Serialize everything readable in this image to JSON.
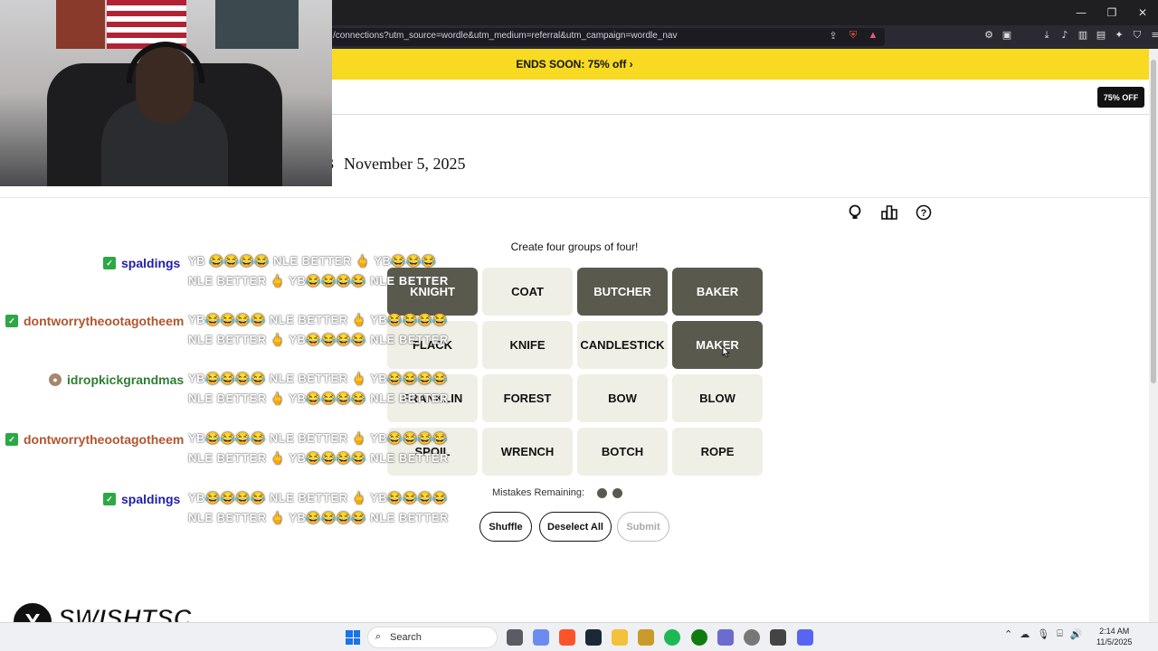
{
  "browser": {
    "url": "/connections?utm_source=wordle&utm_medium=referral&utm_campaign=wordle_nav",
    "window_controls": [
      "—",
      "❐",
      "✕"
    ]
  },
  "promo": {
    "text": "ENDS SOON:  75% off ›"
  },
  "header": {
    "off_button": "75% OFF"
  },
  "game": {
    "date_prefix": "3",
    "date": "November 5, 2025",
    "instructions": "Create four groups of four!",
    "tiles": [
      {
        "word": "KNIGHT",
        "selected": true
      },
      {
        "word": "COAT",
        "selected": false
      },
      {
        "word": "BUTCHER",
        "selected": true
      },
      {
        "word": "BAKER",
        "selected": true
      },
      {
        "word": "FLACK",
        "selected": false
      },
      {
        "word": "KNIFE",
        "selected": false
      },
      {
        "word": "CANDLESTICK",
        "selected": false
      },
      {
        "word": "MAKER",
        "selected": true
      },
      {
        "word": "FRANKLIN",
        "selected": false
      },
      {
        "word": "FOREST",
        "selected": false
      },
      {
        "word": "BOW",
        "selected": false
      },
      {
        "word": "BLOW",
        "selected": false
      },
      {
        "word": "SPOIL",
        "selected": false
      },
      {
        "word": "WRENCH",
        "selected": false
      },
      {
        "word": "BOTCH",
        "selected": false
      },
      {
        "word": "ROPE",
        "selected": false
      }
    ],
    "mistakes_label": "Mistakes Remaining:",
    "mistakes_remaining": 2,
    "buttons": {
      "shuffle": "Shuffle",
      "deselect": "Deselect All",
      "submit": "Submit"
    }
  },
  "chat": [
    {
      "user": "spaldings",
      "color": "#1e1eaa",
      "message": "YB 😂😂😂😂 NLE BETTER 🖕 YB😂😂😂 NLE BETTER 🖕 YB😂😂😂😂 NLE BETTER"
    },
    {
      "user": "dontworrytheootagotheem",
      "color": "#b0552e",
      "message": "YB😂😂😂😂 NLE BETTER 🖕 YB😂😂😂😂 NLE BETTER 🖕 YB😂😂😂😂 NLE BETTER"
    },
    {
      "user": "idropkickgrandmas",
      "color": "#2e7d32",
      "message": "YB😂😂😂😂 NLE BETTER 🖕 YB😂😂😂😂 NLE BETTER 🖕 YB😂😂😂😂 NLE BETTER"
    },
    {
      "user": "dontworrytheootagotheem",
      "color": "#b0552e",
      "message": "YB😂😂😂😂 NLE BETTER 🖕 YB😂😂😂😂 NLE BETTER 🖕 YB😂😂😂😂 NLE BETTER"
    },
    {
      "user": "spaldings",
      "color": "#1e1eaa",
      "message": "YB😂😂😂😂 NLE BETTER 🖕 YB😂😂😂😂 NLE BETTER 🖕 YB😂😂😂😂 NLE BETTER"
    }
  ],
  "chat_overlay_text": "NLE BETTER",
  "taskbar": {
    "search": "Search",
    "time": "2:14 AM",
    "date": "11/5/2025"
  },
  "logo": {
    "text": "SWISHTSC"
  },
  "colors": {
    "promo": "#f7da21",
    "selected_tile": "#5a594e",
    "tile": "#efefe6"
  }
}
